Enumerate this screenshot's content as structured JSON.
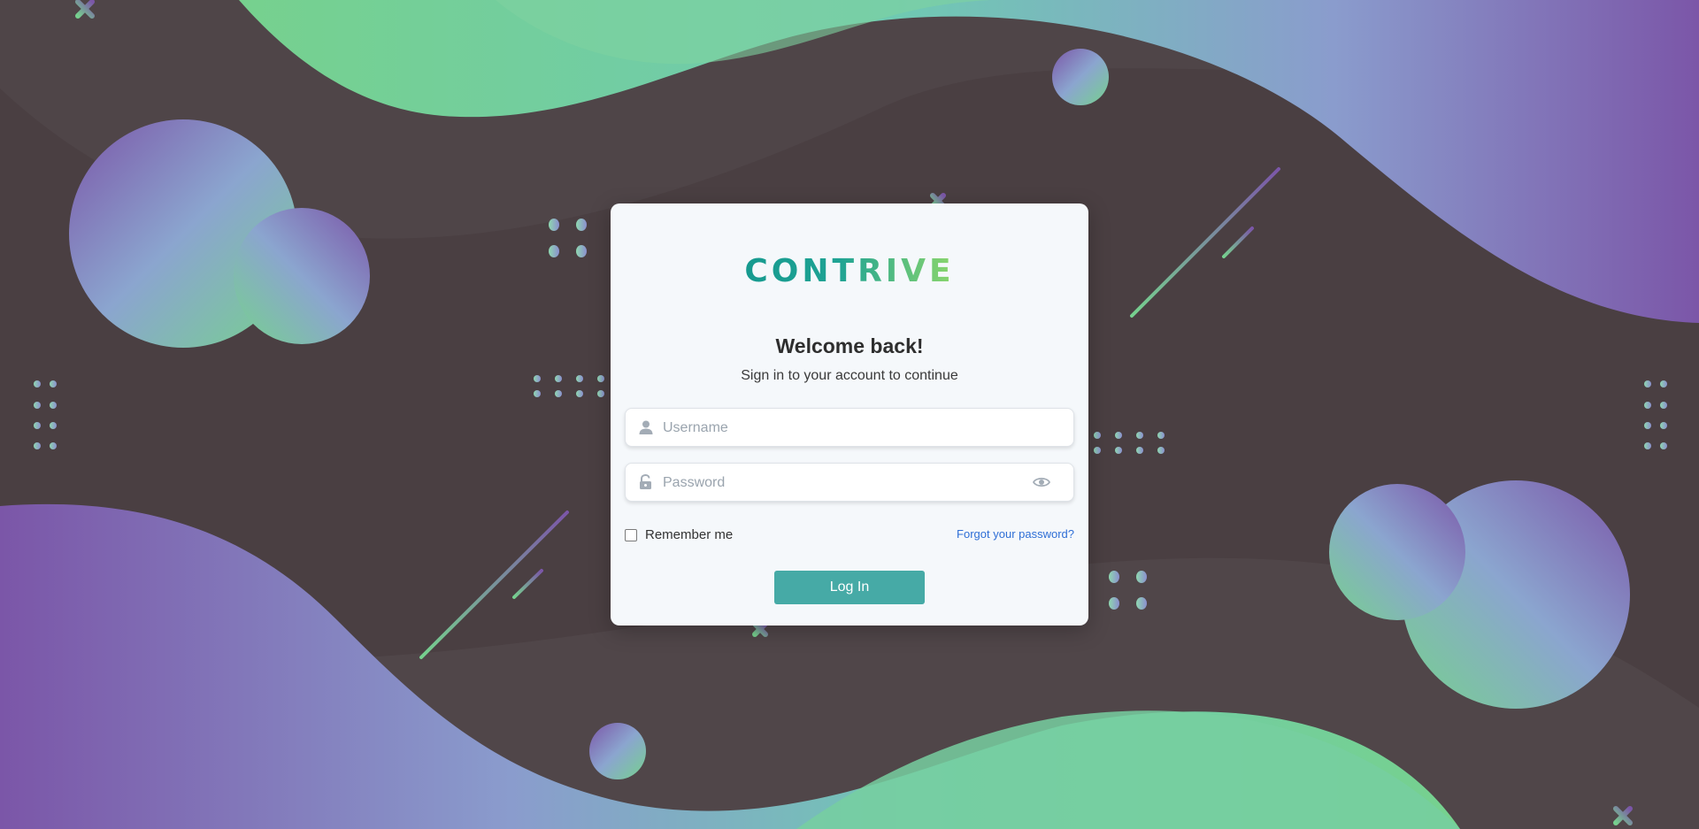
{
  "brand": {
    "logo_text": "CONTRIVE"
  },
  "login": {
    "title": "Welcome back!",
    "subtitle": "Sign in to your account to continue",
    "username_placeholder": "Username",
    "password_placeholder": "Password",
    "remember_label": "Remember me",
    "forgot_label": "Forgot your password?",
    "submit_label": "Log In"
  },
  "icons": {
    "username": "user-icon",
    "password": "unlock-icon",
    "show_password": "eye-icon",
    "remember": "checkbox-unchecked"
  },
  "colors": {
    "page_bg": "#4a3f42",
    "card_bg": "#f5f8fb",
    "primary_button": "#46aaa6",
    "link": "#2f6fd6",
    "accent_green": "#6fd18b",
    "accent_purple": "#7b58a8",
    "accent_teal": "#169a8f"
  }
}
